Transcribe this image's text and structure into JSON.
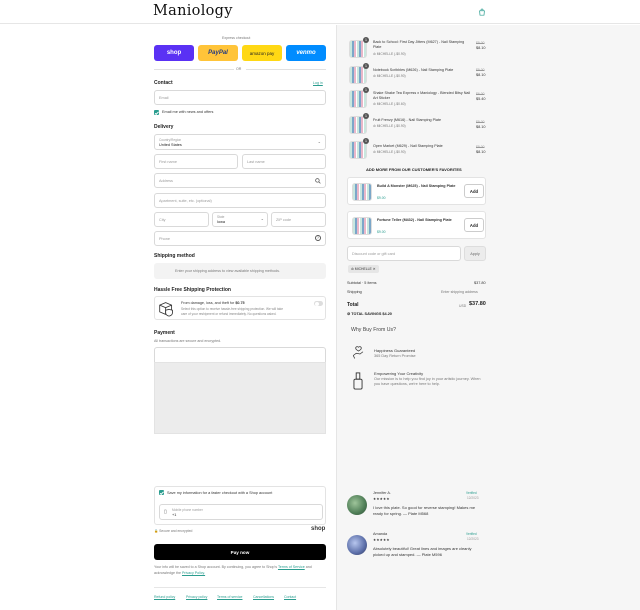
{
  "header": {
    "logo": "Maniology",
    "bag_icon": "shopping-bag-icon"
  },
  "express": {
    "title": "Express checkout",
    "buttons": [
      {
        "label": "shop",
        "color": "#5a31f4"
      },
      {
        "label": "PayPal",
        "color": "#ffc439"
      },
      {
        "label": "amazon pay",
        "color": "#ffd814"
      },
      {
        "label": "venmo",
        "color": "#008cff"
      }
    ],
    "or": "OR"
  },
  "contact": {
    "title": "Contact",
    "login": "Log in",
    "email_placeholder": "Email",
    "newsletter": "Email me with news and offers"
  },
  "delivery": {
    "title": "Delivery",
    "country_label": "Country/Region",
    "country_value": "United States",
    "first_name": "First name",
    "last_name": "Last name",
    "address": "Address",
    "apartment": "Apartment, suite, etc. (optional)",
    "city": "City",
    "state_label": "State",
    "state_value": "Iowa",
    "zip": "ZIP code",
    "phone": "Phone"
  },
  "shipping": {
    "title": "Shipping method",
    "message": "Enter your shipping address to view available shipping methods."
  },
  "protection": {
    "title": "Hassle Free Shipping Protection",
    "line1_prefix": "From damage, loss, and theft for",
    "line1_price": "$0.75",
    "line2": "Select this option to receive hassle-free shipping protection. We will take",
    "line3": "care of your reshipment or refund immediately. No questions asked."
  },
  "payment": {
    "title": "Payment",
    "subtitle": "All transactions are secure and encrypted."
  },
  "save": {
    "label": "Save my information for a faster checkout with a Shop account",
    "phone_label": "Mobile phone number",
    "phone_value": "+1",
    "secure": "Secure and encrypted",
    "shop_logo": "shop"
  },
  "pay_now": "Pay now",
  "terms": {
    "line1_prefix": "Your info will be saved to a Shop account. By continuing, you agree to Shop's",
    "terms_link": "Terms of Service",
    "and_ack": "and acknowledge the",
    "privacy_link": "Privacy Policy."
  },
  "footer_links": [
    "Refund policy",
    "Privacy policy",
    "Terms of service",
    "Cancellations",
    "Contact"
  ],
  "cart": {
    "items": [
      {
        "qty": "1",
        "title": "Back to School: First Day Jitters (M627) - Nail Stamping Plate",
        "sub": "MICHELLE (-$0.90)",
        "was": "$9.00",
        "price": "$8.10"
      },
      {
        "qty": "1",
        "title": "Notebook Scribbles (M626) - Nail Stamping Plate",
        "sub": "MICHELLE (-$0.90)",
        "was": "$9.00",
        "price": "$8.10"
      },
      {
        "qty": "1",
        "title": "Shake Shake Tea Express x Maniology - Blended Bitsy Nail Art Sticker",
        "sub": "MICHELLE (-$0.60)",
        "was": "$6.00",
        "price": "$5.40"
      },
      {
        "qty": "1",
        "title": "Fruit Frenzy (M616) - Nail Stamping Plate",
        "sub": "MICHELLE (-$0.90)",
        "was": "$9.00",
        "price": "$8.10"
      },
      {
        "qty": "1",
        "title": "Open Market (M629) - Nail Stamping Plate",
        "sub": "MICHELLE (-$0.90)",
        "was": "$9.00",
        "price": "$8.10"
      }
    ],
    "favorites_title": "ADD MORE FROM OUR CUSTOMER'S FAVORITES",
    "favorites": [
      {
        "title": "Build A Monster (M625) - Nail Stamping Plate",
        "price": "$9.00",
        "add": "Add"
      },
      {
        "title": "Fortune Teller (M432) - Nail Stamping Plate",
        "price": "$9.00",
        "add": "Add"
      }
    ],
    "discount_placeholder": "Discount code or gift card",
    "apply": "Apply",
    "applied_code": "MICHELLE",
    "subtotal_label": "Subtotal · 5 items",
    "subtotal_value": "$37.80",
    "shipping_label": "Shipping",
    "shipping_value": "Enter shipping address",
    "total_label": "Total",
    "currency": "USD",
    "total_value": "$37.80",
    "savings_label": "TOTAL SAVINGS",
    "savings_value": "$4.20"
  },
  "why": {
    "title": "Why Buy From Us?",
    "points": [
      {
        "title": "Happiness Guaranteed",
        "text": "365 Day Return Promise"
      },
      {
        "title": "Empowering Your Creativity",
        "text": "Our mission is to help you find joy in your artistic journey. When you have questions, we're here to help."
      }
    ]
  },
  "reviews": [
    {
      "name": "Jennifer A.",
      "badge": "Verified",
      "date": "12/2023",
      "stars": "★★★★★",
      "text": "I love this plate. So good for reverse stamping! Makes me ready for spring. — Plate M568"
    },
    {
      "name": "Amanda",
      "badge": "Verified",
      "date": "12/2023",
      "stars": "★★★★★",
      "text": "Absolutely beautiful! Great lines and images are cleanly picked up and stamped. — Plate M596"
    }
  ]
}
